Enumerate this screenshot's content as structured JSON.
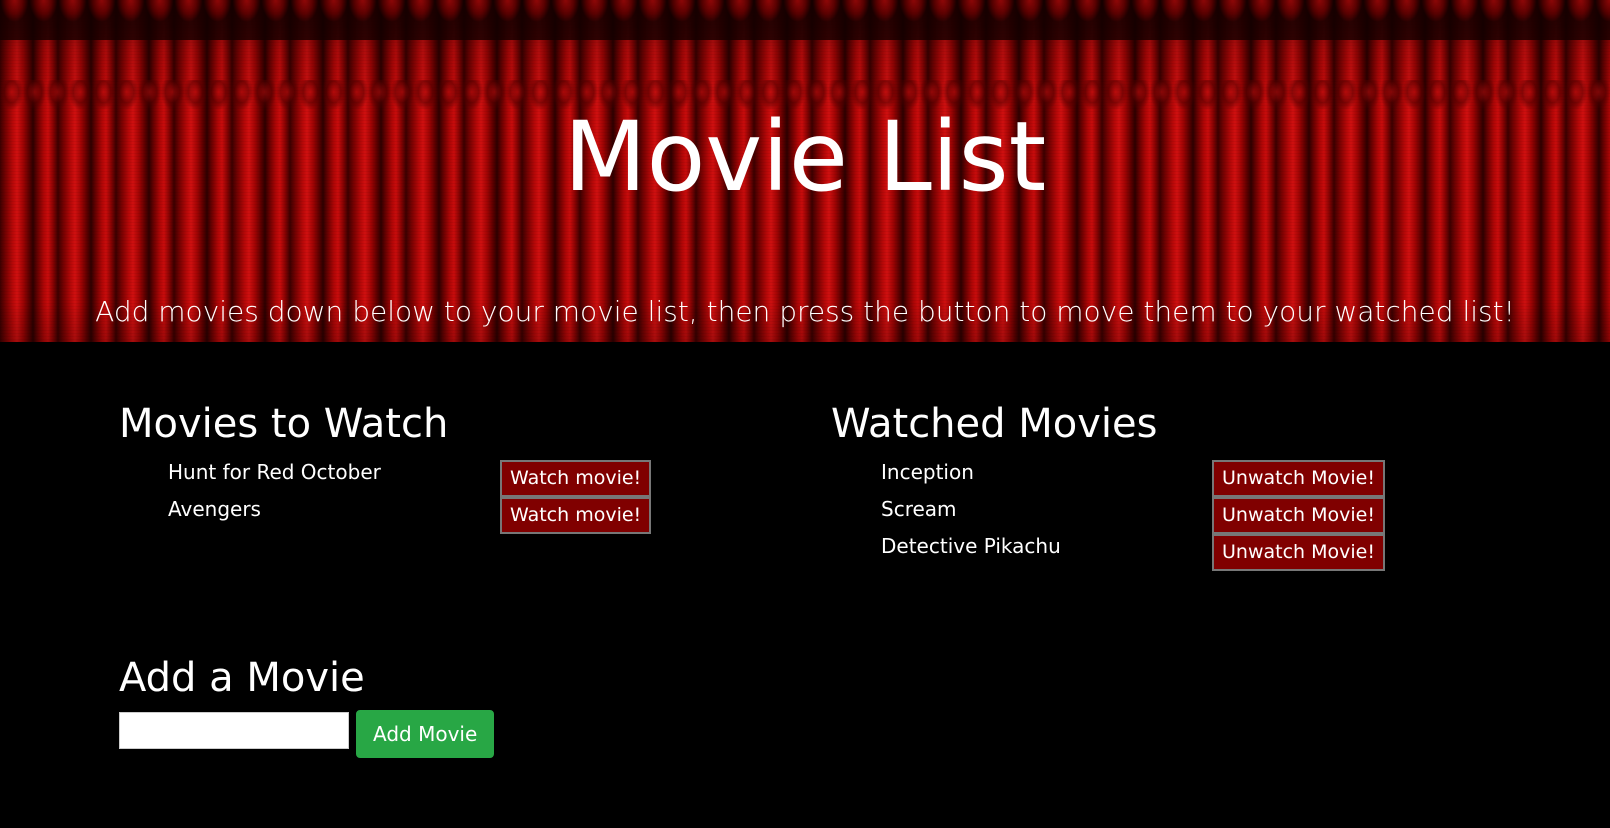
{
  "hero": {
    "title": "Movie List",
    "subtitle": "Add movies down below to your movie list, then press the button to move them to your watched list!"
  },
  "to_watch": {
    "heading": "Movies to Watch",
    "items": [
      {
        "name": "Hunt for Red October",
        "button_label": "Watch movie!"
      },
      {
        "name": "Avengers",
        "button_label": "Watch movie!"
      }
    ]
  },
  "watched": {
    "heading": "Watched Movies",
    "items": [
      {
        "name": "Inception",
        "button_label": "Unwatch Movie!"
      },
      {
        "name": "Scream",
        "button_label": "Unwatch Movie!"
      },
      {
        "name": "Detective Pikachu",
        "button_label": "Unwatch Movie!"
      }
    ]
  },
  "add_movie": {
    "heading": "Add a Movie",
    "input_value": "",
    "input_placeholder": "",
    "button_label": "Add Movie"
  },
  "colors": {
    "page_background": "#000000",
    "curtain_red": "#b80808",
    "movie_button": "#800000",
    "add_button": "#28a745"
  }
}
